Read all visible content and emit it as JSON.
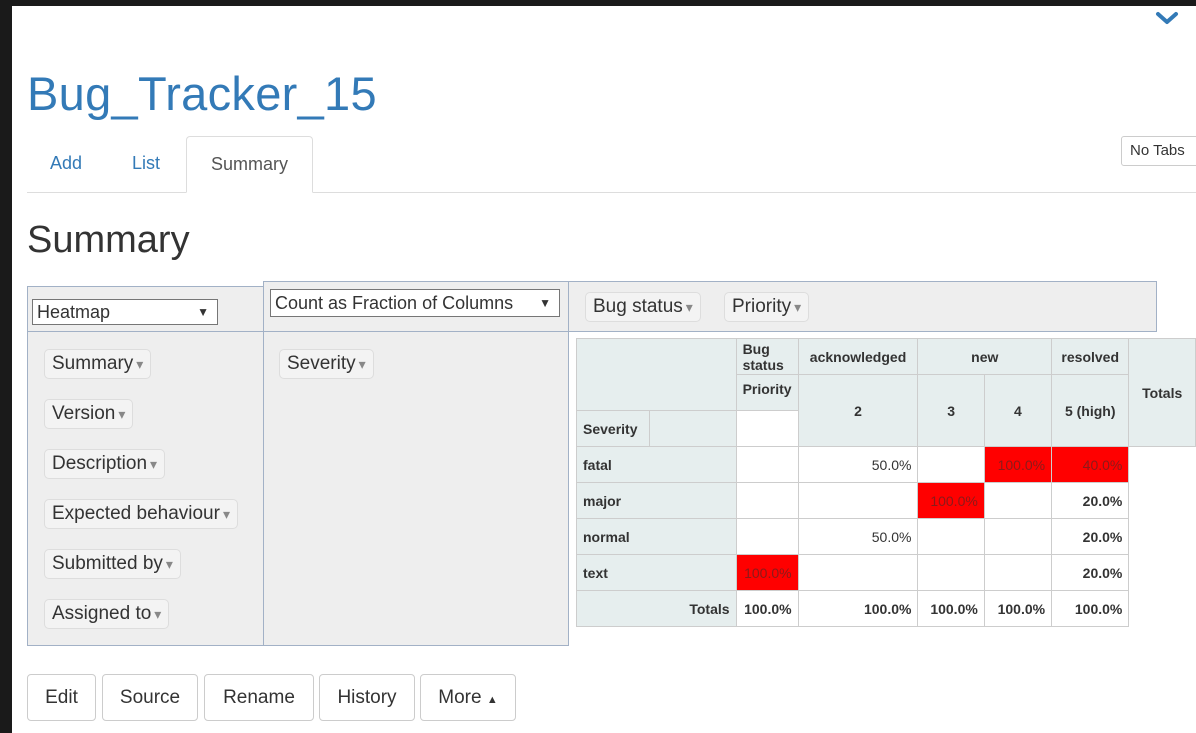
{
  "window": {
    "title": "Bug_Tracker_15"
  },
  "tabs": [
    {
      "label": "Add"
    },
    {
      "label": "List"
    },
    {
      "label": "Summary"
    }
  ],
  "no_tabs_label": "No Tabs",
  "section_heading": "Summary",
  "controls": {
    "renderer": "Heatmap",
    "aggregator": "Count as Fraction of Columns",
    "column_attrs": [
      "Bug status",
      "Priority"
    ],
    "row_attrs": [
      "Severity"
    ],
    "unused_attrs": [
      "Summary",
      "Version",
      "Description",
      "Expected behaviour",
      "Submitted by",
      "Assigned to"
    ]
  },
  "pivot": {
    "col_attr_labels": [
      "Bug status",
      "Priority"
    ],
    "row_attr_label": "Severity",
    "status_groups": [
      "acknowledged",
      "new",
      "resolved"
    ],
    "priorities": [
      "2",
      "3",
      "4",
      "5 (high)"
    ],
    "totals_label": "Totals",
    "rows": [
      {
        "label": "fatal",
        "cells": [
          "",
          "50.0%",
          "",
          "100.0%"
        ],
        "total": "40.0%"
      },
      {
        "label": "major",
        "cells": [
          "",
          "",
          "100.0%",
          ""
        ],
        "total": "20.0%"
      },
      {
        "label": "normal",
        "cells": [
          "",
          "50.0%",
          "",
          ""
        ],
        "total": "20.0%"
      },
      {
        "label": "text",
        "cells": [
          "100.0%",
          "",
          "",
          ""
        ],
        "total": "20.0%"
      }
    ],
    "col_totals": [
      "100.0%",
      "100.0%",
      "100.0%",
      "100.0%"
    ],
    "grand_total": "100.0%",
    "heat_color": "#ff0000"
  },
  "buttons": {
    "edit": "Edit",
    "source": "Source",
    "rename": "Rename",
    "history": "History",
    "more": "More"
  },
  "colors": {
    "link": "#337ab7",
    "heat": "#ff0000"
  }
}
